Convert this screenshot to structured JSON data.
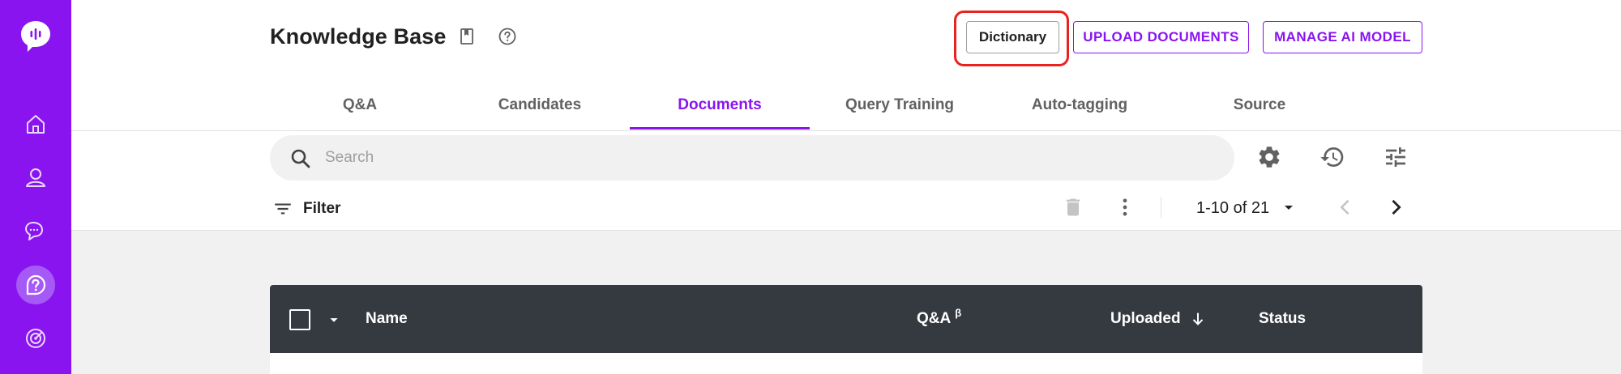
{
  "page": {
    "title": "Knowledge Base"
  },
  "header": {
    "dictionary_label": "Dictionary",
    "upload_label": "UPLOAD DOCUMENTS",
    "manage_label": "MANAGE AI MODEL"
  },
  "tabs": [
    {
      "label": "Q&A",
      "active": false
    },
    {
      "label": "Candidates",
      "active": false
    },
    {
      "label": "Documents",
      "active": true
    },
    {
      "label": "Query Training",
      "active": false
    },
    {
      "label": "Auto-tagging",
      "active": false
    },
    {
      "label": "Source",
      "active": false
    }
  ],
  "search": {
    "placeholder": "Search",
    "value": ""
  },
  "toolbar": {
    "filter_label": "Filter",
    "pagination": "1-10 of 21"
  },
  "table": {
    "columns": {
      "name": "Name",
      "qa": "Q&A",
      "qa_superscript": "β",
      "uploaded": "Uploaded",
      "status": "Status"
    }
  },
  "sidebar": {
    "items": [
      {
        "icon": "home-icon"
      },
      {
        "icon": "user-icon"
      },
      {
        "icon": "chat-icon"
      },
      {
        "icon": "knowledge-base-icon",
        "active": true
      },
      {
        "icon": "radar-icon"
      }
    ]
  },
  "colors": {
    "brand": "#8a14f0",
    "highlight": "#e8231f",
    "table_header": "#353a40"
  }
}
